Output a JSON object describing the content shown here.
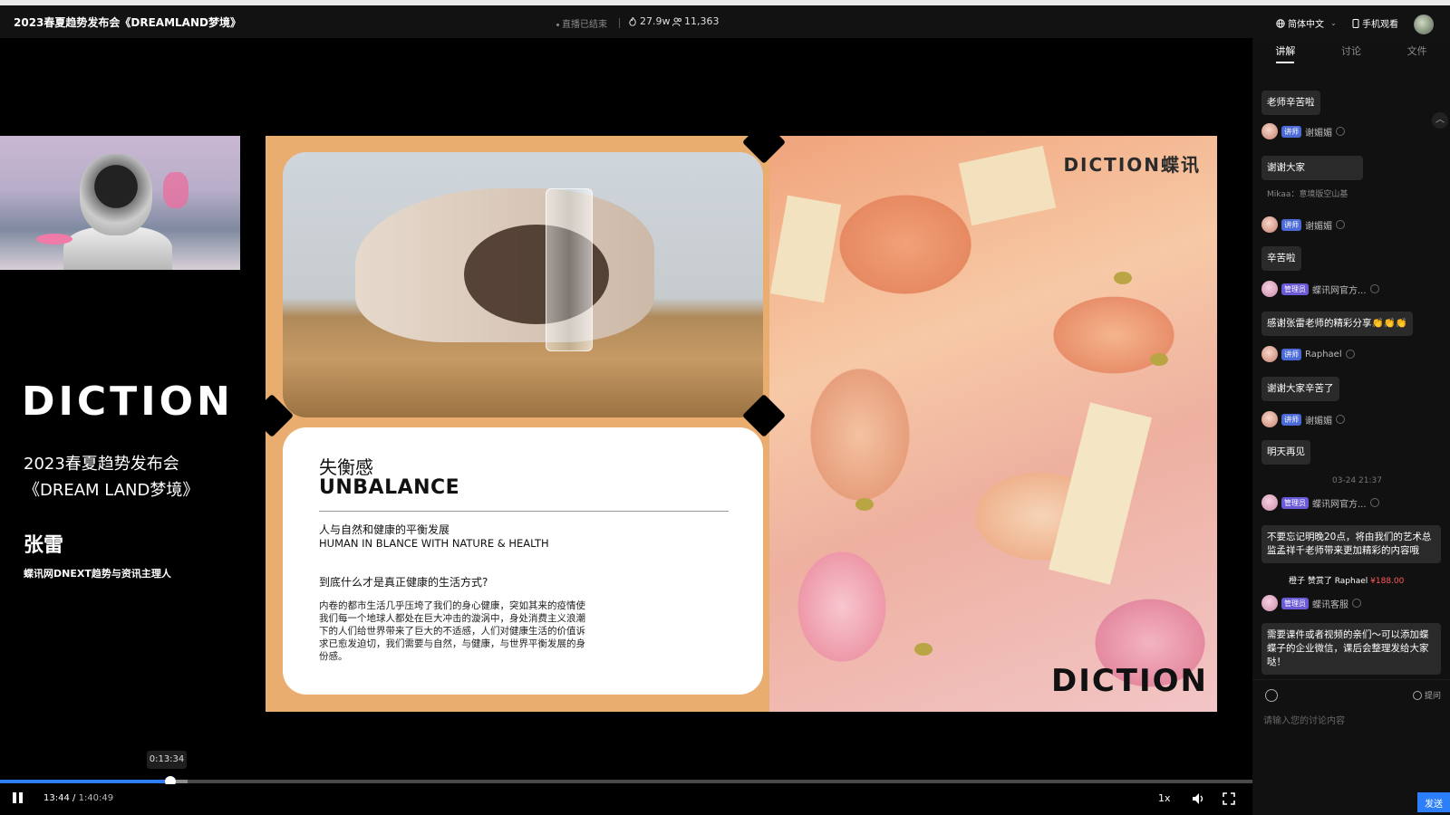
{
  "header": {
    "title": "2023春夏趋势发布会《DREAMLAND梦境》",
    "live_status": "直播已结束",
    "likes": "27.9w",
    "viewers": "11,363",
    "language": "简体中文",
    "mobile_watch": "手机观看"
  },
  "stage": {
    "brand": "DICTION",
    "event_line1": "2023春夏趋势发布会",
    "event_line2": "《DREAM LAND梦境》",
    "speaker_name": "张雷",
    "speaker_role": "蝶讯网DNEXT趋势与资讯主理人"
  },
  "slide": {
    "zh_title": "失衡感",
    "en_title": "UNBALANCE",
    "subtitle_zh": "人与自然和健康的平衡发展",
    "subtitle_en": "HUMAN IN BLANCE WITH NATURE & HEALTH",
    "question": "到底什么才是真正健康的生活方式?",
    "body": "内卷的都市生活几乎压垮了我们的身心健康，突如其来的疫情使我们每一个地球人都处在巨大冲击的漩涡中，身处消费主义浪潮下的人们给世界带来了巨大的不适感，人们对健康生活的价值诉求已愈发迫切，我们需要与自然，与健康，与世界平衡发展的身份感。",
    "logo_top": "DICTION蝶讯",
    "logo_bottom": "DICTION"
  },
  "player": {
    "tooltip_time": "0:13:34",
    "current_time": "13:44",
    "divider": "/",
    "total_time": "1:40:49",
    "played_fraction": 0.1358,
    "buffered_fraction": 0.15,
    "speed": "1x",
    "accent_color": "#2d7ff9"
  },
  "panel": {
    "tabs": [
      "讲解",
      "讨论",
      "文件"
    ],
    "active_tab": 0,
    "chat": {
      "m1_text": "老师辛苦啦",
      "m2_badge": "讲师",
      "m2_name": "谢媚媚",
      "m2_text": "谢谢大家",
      "m2_quote": "Mikaa：意境版空山基",
      "m3_badge": "讲师",
      "m3_name": "谢媚媚",
      "m3_text": "辛苦啦",
      "m4_badge": "管理员",
      "m4_name": "蝶讯网官方...",
      "m4_text": "感谢张雷老师的精彩分享👏👏👏",
      "m5_badge": "讲师",
      "m5_name": "Raphael",
      "m5_text": "谢谢大家辛苦了",
      "m6_badge": "讲师",
      "m6_name": "谢媚媚",
      "m6_text": "明天再见",
      "sys_time": "03-24 21:37",
      "m7_badge": "管理员",
      "m7_name": "蝶讯网官方...",
      "m7_text": "不要忘记明晚20点，将由我们的艺术总监孟祥千老师带来更加精彩的内容哦",
      "gift_text": "橙子 赞赏了 Raphael",
      "gift_amount": "¥188.00",
      "m8_badge": "管理员",
      "m8_name": "蝶讯客服",
      "m8_text": "需要课件或者视频的亲们～可以添加蝶蝶子的企业微信，课后会整理发给大家哒！"
    },
    "ask_label": "提问",
    "input_placeholder": "请输入您的讨论内容",
    "send_label": "发送"
  }
}
